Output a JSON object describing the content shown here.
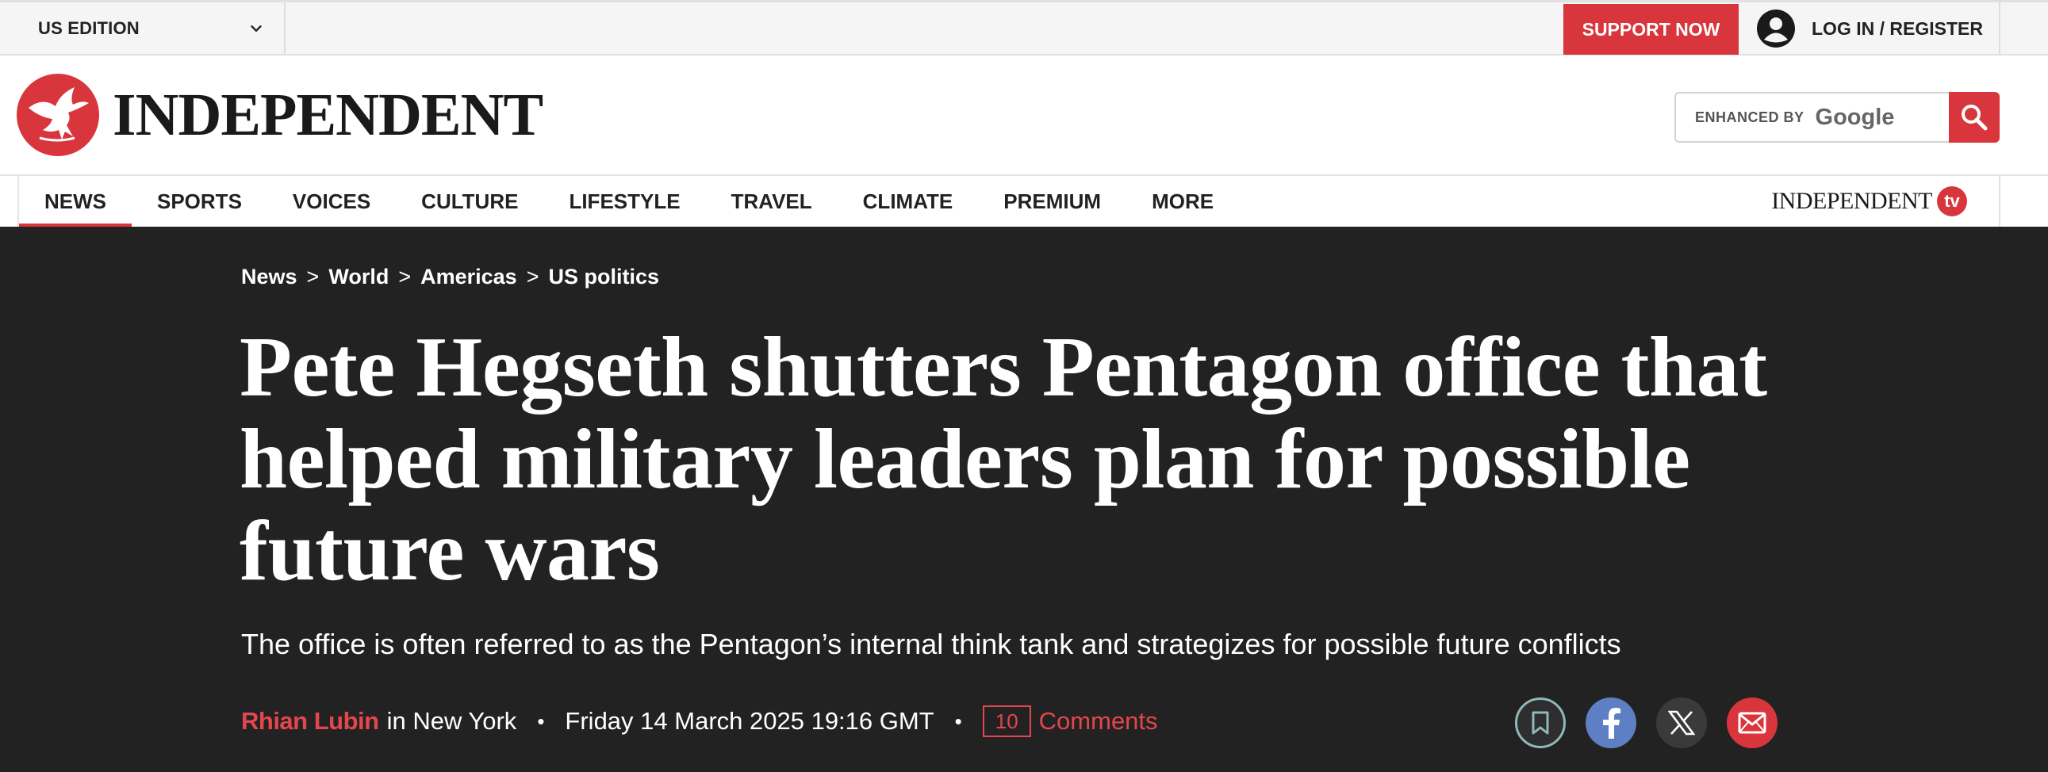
{
  "topbar": {
    "edition": "US EDITION",
    "support": "SUPPORT NOW",
    "login": "LOG IN / REGISTER"
  },
  "masthead": {
    "logo_text": "INDEPENDENT",
    "search_enhanced": "ENHANCED BY",
    "search_google": "Google"
  },
  "nav": {
    "items": [
      "NEWS",
      "SPORTS",
      "VOICES",
      "CULTURE",
      "LIFESTYLE",
      "TRAVEL",
      "CLIMATE",
      "PREMIUM",
      "MORE"
    ],
    "active": "NEWS",
    "tv_text": "INDEPENDENT",
    "tv_badge": "tv"
  },
  "article": {
    "breadcrumb": [
      "News",
      "World",
      "Americas",
      "US politics"
    ],
    "headline": "Pete Hegseth shutters Pentagon office that helped military leaders plan for possible future wars",
    "subheadline": "The office is often referred to as the Pentagon’s internal think tank and strategizes for possible future conflicts",
    "author": "Rhian Lubin",
    "location": "in New York",
    "date": "Friday 14 March 2025 19:16 GMT",
    "comment_count": "10",
    "comments_label": "Comments"
  },
  "colors": {
    "brand_red": "#d8353c",
    "hero_bg": "#222222"
  }
}
